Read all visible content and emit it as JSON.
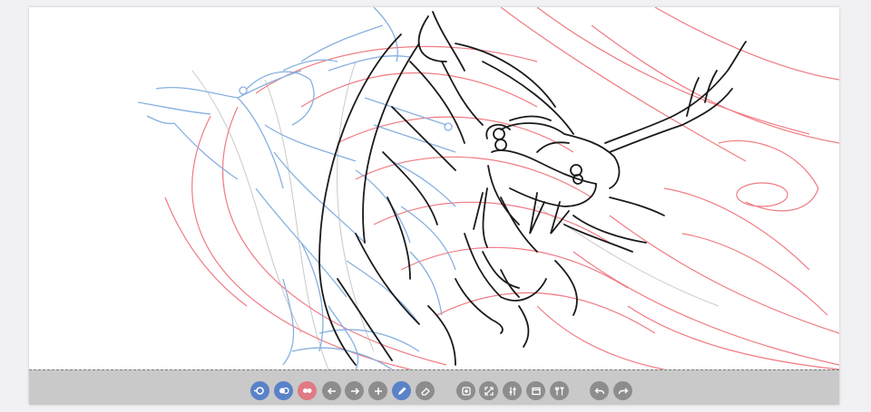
{
  "app": {
    "background_color": "#f1f1f3",
    "canvas_color": "#ffffff",
    "toolbar_color": "#c9c9c9"
  },
  "canvas": {
    "layers": [
      {
        "name": "rough-sketch-layer",
        "color": "#f07b83"
      },
      {
        "name": "blue-sketch-layer",
        "color": "#86b0e0"
      },
      {
        "name": "ink-layer",
        "color": "#1a1a1a"
      }
    ]
  },
  "toolbar": {
    "button_color_default": "#8d8d8d",
    "button_color_active": "#5a82c8",
    "button_color_highlight": "#e07a84",
    "buttons": [
      {
        "name": "layer-visibility-button",
        "icon": "visibility-toggle-icon",
        "state": "active"
      },
      {
        "name": "layer-blend-button",
        "icon": "layer-blend-icon",
        "state": "active"
      },
      {
        "name": "layer-color-button",
        "icon": "layer-color-icon",
        "state": "highlight"
      },
      {
        "name": "previous-frame-button",
        "icon": "arrow-left-icon",
        "state": "default"
      },
      {
        "name": "next-frame-button",
        "icon": "arrow-right-icon",
        "state": "default"
      },
      {
        "name": "add-frame-button",
        "icon": "plus-icon",
        "state": "default"
      },
      {
        "name": "pen-tool-button",
        "icon": "pen-icon",
        "state": "active"
      },
      {
        "name": "eraser-tool-button",
        "icon": "eraser-icon",
        "state": "default"
      },
      {
        "name": "record-button",
        "icon": "record-icon",
        "state": "default"
      },
      {
        "name": "fit-view-button",
        "icon": "expand-icon",
        "state": "default"
      },
      {
        "name": "adjust-button",
        "icon": "sliders-icon",
        "state": "default"
      },
      {
        "name": "frames-button",
        "icon": "frames-icon",
        "state": "default"
      },
      {
        "name": "tools-button",
        "icon": "tools-icon",
        "state": "default"
      },
      {
        "name": "undo-button",
        "icon": "undo-icon",
        "state": "default"
      },
      {
        "name": "redo-button",
        "icon": "redo-icon",
        "state": "default"
      }
    ]
  }
}
